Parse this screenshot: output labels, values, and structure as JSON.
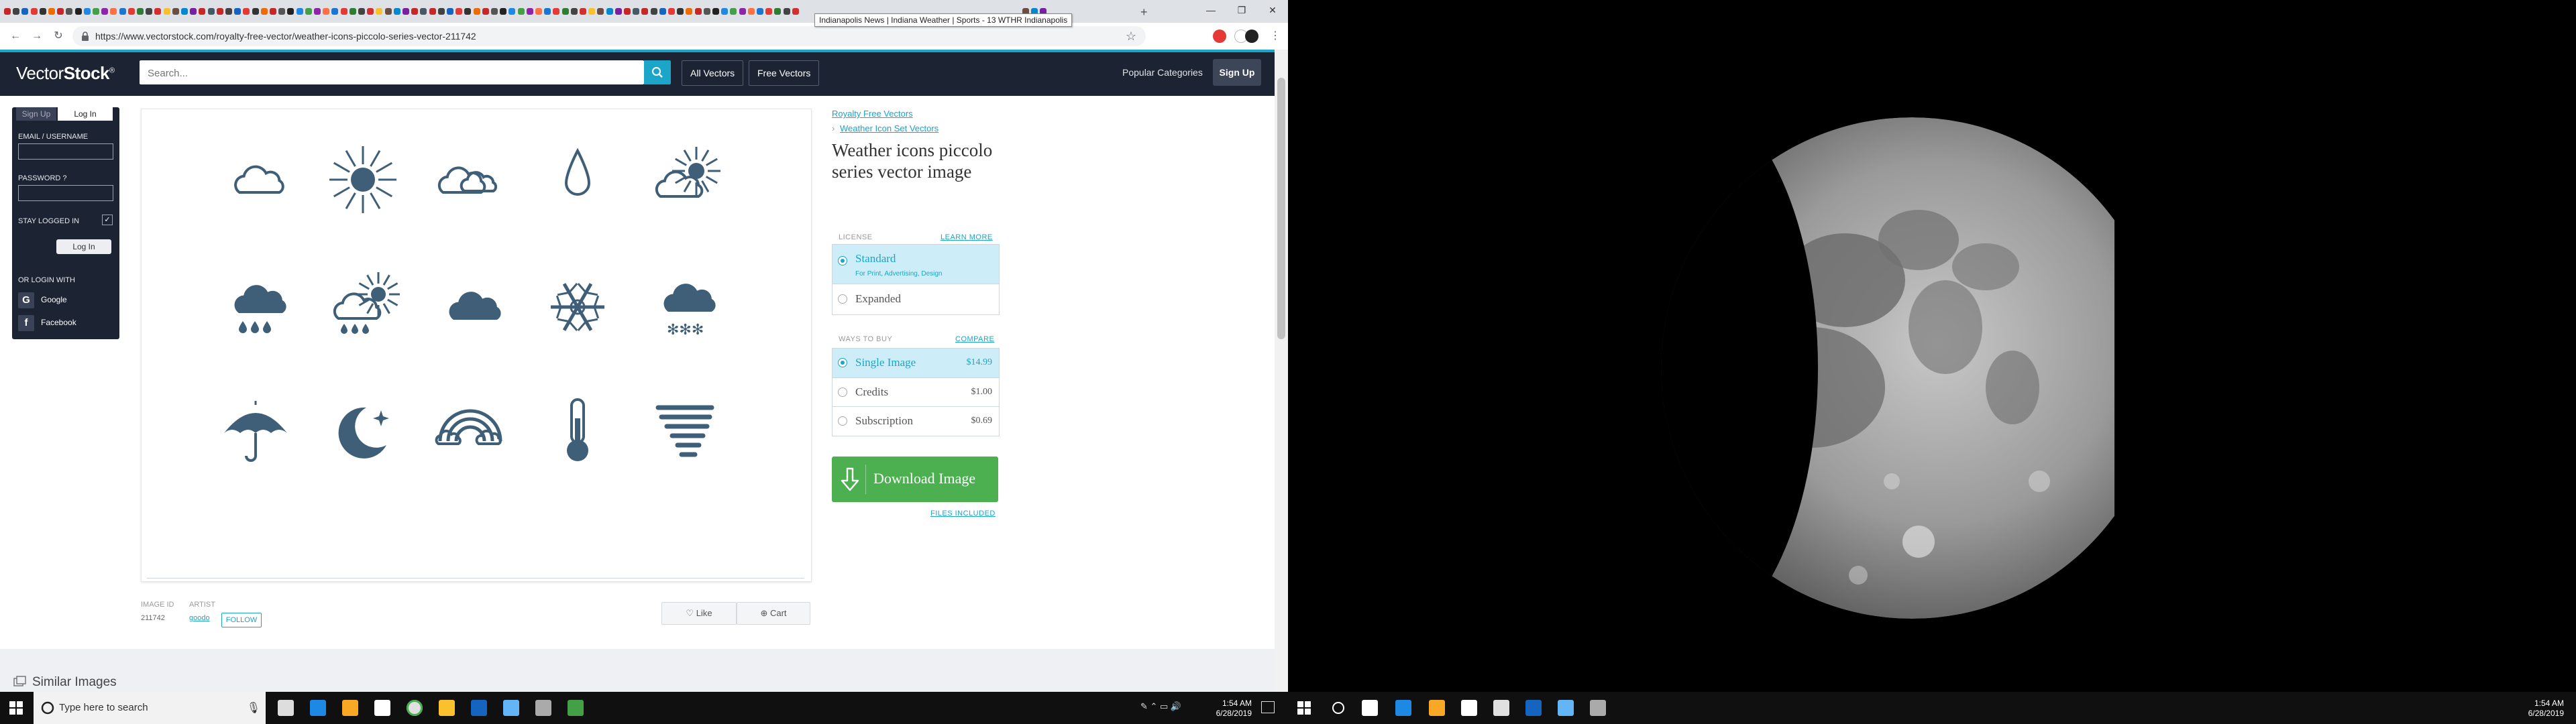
{
  "browser": {
    "tooltip": "Indianapolis News | Indiana Weather | Sports - 13 WTHR Indianapolis",
    "url": "https://www.vectorstock.com/royalty-free-vector/weather-icons-piccolo-series-vector-211742",
    "window_controls": [
      "—",
      "❐",
      "✕"
    ]
  },
  "site": {
    "logo_prefix": "Vector",
    "logo_suffix": "Stock",
    "logo_mark": "®",
    "search_placeholder": "Search...",
    "nav": {
      "all_vectors": "All Vectors",
      "free_vectors": "Free Vectors",
      "popular_categories": "Popular Categories",
      "sign_up": "Sign Up"
    }
  },
  "login_panel": {
    "tab_signup": "Sign Up",
    "tab_login": "Log In",
    "email_label": "EMAIL / USERNAME",
    "password_label": "PASSWORD",
    "password_help": "?",
    "stay_logged_in": "STAY LOGGED IN",
    "login_button": "Log In",
    "or_login_with": "OR LOGIN WITH",
    "google": "Google",
    "facebook": "Facebook"
  },
  "item": {
    "breadcrumb_1": "Royalty Free Vectors",
    "breadcrumb_sep": "›",
    "breadcrumb_2": "Weather Icon Set Vectors",
    "title": "Weather icons piccolo series vector image",
    "image_id_label": "IMAGE ID",
    "image_id": "211742",
    "artist_label": "ARTIST",
    "artist": "goodo",
    "follow": "FOLLOW",
    "like": "Like",
    "cart": "Cart",
    "weather_icons": [
      "cloud-icon",
      "sun-icon",
      "double-cloud-icon",
      "raindrop-icon",
      "sun-behind-cloud-icon",
      "rain-cloud-icon",
      "sun-rain-cloud-icon",
      "dark-cloud-icon",
      "snowflake-icon",
      "snow-cloud-icon",
      "umbrella-icon",
      "moon-star-icon",
      "rainbow-icon",
      "thermometer-icon",
      "tornado-icon"
    ],
    "icon_color": "#3f5f78"
  },
  "license": {
    "label": "LICENSE",
    "learn_more": "LEARN MORE",
    "standard": "Standard",
    "standard_sub": "For Print, Advertising, Design",
    "expanded": "Expanded"
  },
  "buy": {
    "label": "WAYS TO BUY",
    "compare": "COMPARE",
    "options": [
      {
        "name": "Single Image",
        "price": "$14.99"
      },
      {
        "name": "Credits",
        "price": "$1.00"
      },
      {
        "name": "Subscription",
        "price": "$0.69"
      }
    ],
    "download": "Download Image",
    "files_included": "FILES INCLUDED"
  },
  "similar": {
    "title": "Similar Images"
  },
  "taskbar": {
    "search_placeholder": "Type here to search",
    "time_left": "1:54 AM",
    "date_left": "6/28/2019",
    "time_right": "1:54 AM",
    "date_right": "6/28/2019"
  },
  "colors": {
    "accent": "#1aa5c9",
    "header": "#1c2333",
    "download_green": "#4caf50"
  }
}
